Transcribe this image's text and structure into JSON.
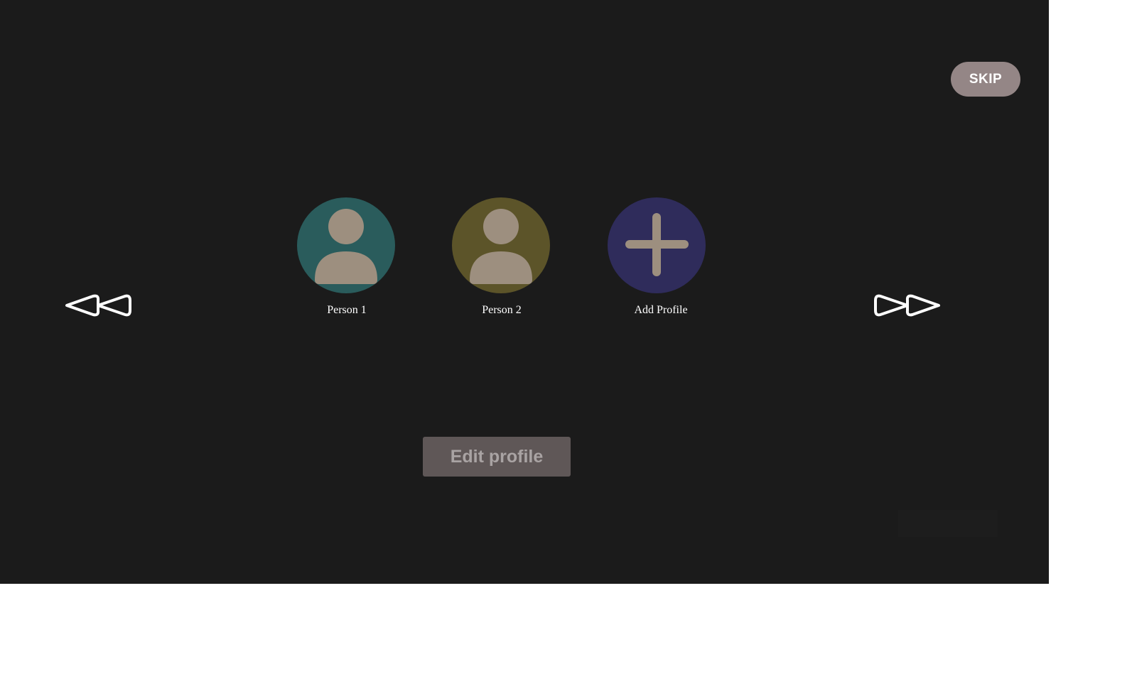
{
  "header": {
    "skip_label": "SKIP"
  },
  "profiles": [
    {
      "label": "Person 1",
      "icon": "person-icon",
      "color": "#2a5c5c"
    },
    {
      "label": "Person 2",
      "icon": "person-icon",
      "color": "#5c5429"
    },
    {
      "label": "Add Profile",
      "icon": "plus-icon",
      "color": "#2f2c5b"
    }
  ],
  "navigation": {
    "previous_icon": "double-chevron-left-icon",
    "next_icon": "double-chevron-right-icon"
  },
  "footer": {
    "edit_label": "Edit profile"
  },
  "colors": {
    "background": "#1b1b1b",
    "skip_button": "#948686",
    "edit_button": "#5f5757",
    "avatar_figure": "#9d8f7f"
  }
}
